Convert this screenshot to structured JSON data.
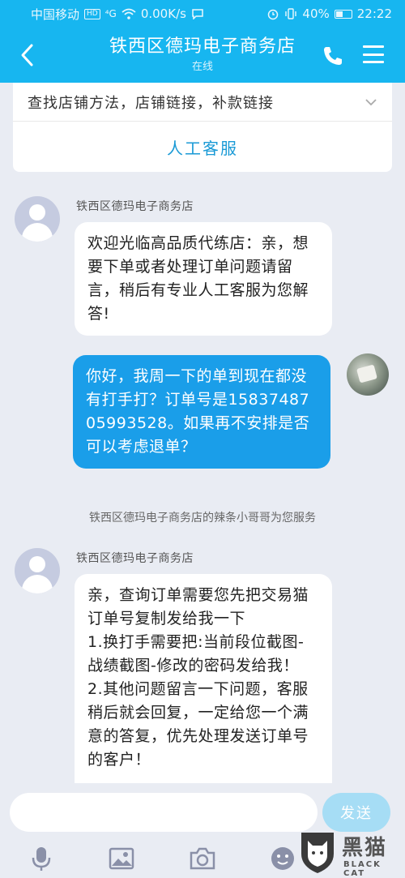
{
  "status_bar": {
    "carrier": "中国移动",
    "net_badge": "HD",
    "signal_label": "⁴G",
    "speed": "0.00K/s",
    "battery": "40%",
    "time": "22:22"
  },
  "header": {
    "title": "铁西区德玛电子商务店",
    "subtitle": "在线"
  },
  "card": {
    "menu_text": "查找店铺方法，店铺链接，补款链接",
    "service_label": "人工客服"
  },
  "messages": [
    {
      "sender": "铁西区德玛电子商务店",
      "text": "欢迎光临高品质代练店：亲，想要下单或者处理订单问题请留言，稍后有专业人工客服为您解答!"
    },
    {
      "sender": "",
      "text": "你好，我周一下的单到现在都没有打手打？订单号是1583748705993528。如果再不安排是否可以考虑退单？"
    },
    {
      "sender": "铁西区德玛电子商务店",
      "text": "亲，查询订单需要您先把交易猫订单号复制发给我一下\n1.换打手需要把:当前段位截图-战绩截图-修改的密码发给我！\n2.其他问题留言一下问题，客服稍后就会回复，一定给您一个满意的答复，优先处理发送订单号的客户！"
    }
  ],
  "system_note": "铁西区德玛电子商务店的辣条小哥哥为您服务",
  "input": {
    "placeholder": "",
    "send_label": "发送"
  },
  "toolbar_icons": [
    "microphone-icon",
    "image-icon",
    "camera-icon",
    "emoji-icon"
  ],
  "watermark": {
    "text": "黑猫",
    "sub": "BLACK CAT"
  },
  "colors": {
    "header_bg": "#17b6f0",
    "bubble_right": "#1a9ee9",
    "link": "#1a9ad6"
  }
}
